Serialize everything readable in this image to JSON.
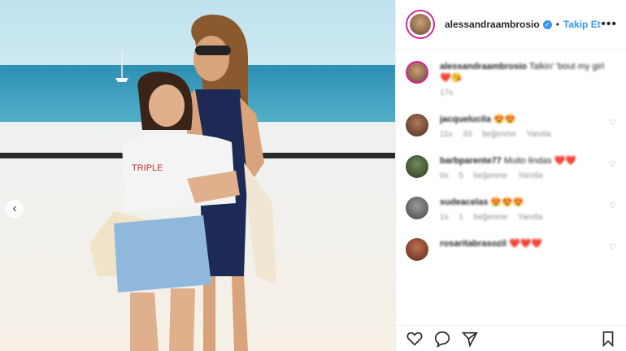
{
  "post": {
    "username": "alessandraambrosio",
    "follow_label": "Takip Et",
    "more_label": "•••",
    "prev_label": "‹"
  },
  "caption": {
    "username": "alessandraambrosio",
    "text": "Talkin' 'bout my girl ❤️😘",
    "time": "17s"
  },
  "comments": [
    {
      "username": "jacquelucila",
      "text": "😍😍",
      "time": "11s",
      "likes": "33 beğenme",
      "reply": "Yanıtla"
    },
    {
      "username": "barbparente77",
      "text": "Muito lindas ❤️❤️",
      "time": "6s",
      "likes": "5 beğenme",
      "reply": "Yanıtla"
    },
    {
      "username": "sudeacelas",
      "text": "😍😍😍",
      "time": "1s",
      "likes": "1 beğenme",
      "reply": "Yanıtla"
    },
    {
      "username": "rosaritabrasozil",
      "text": "❤️❤️❤️",
      "time": "",
      "likes": "",
      "reply": ""
    }
  ],
  "icons": {
    "like": "heart-icon",
    "comment": "comment-icon",
    "share": "share-icon",
    "save": "bookmark-icon"
  }
}
